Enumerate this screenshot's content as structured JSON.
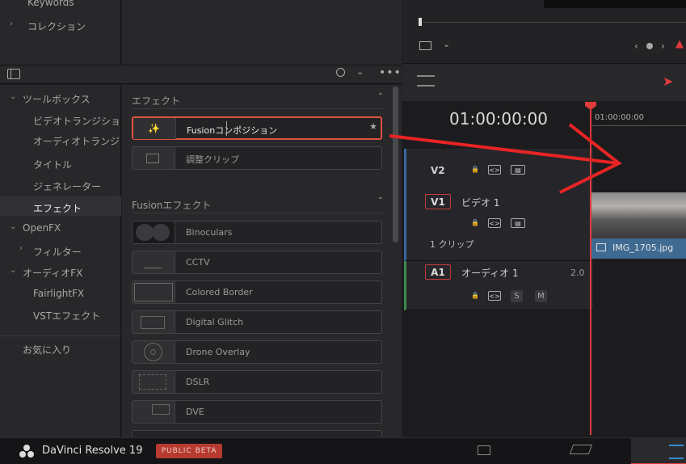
{
  "library": {
    "keywords": "Keywords",
    "collection": "コレクション"
  },
  "tree": {
    "toolbox": "ツールボックス",
    "video_transition": "ビデオトランジション",
    "audio_transition": "オーディオトランジシ...",
    "titles": "タイトル",
    "generators": "ジェネレーター",
    "effects": "エフェクト",
    "openfx": "OpenFX",
    "filters": "フィルター",
    "audiofx": "オーディオFX",
    "fairlightfx": "FairlightFX",
    "vst": "VSTエフェクト",
    "favorites": "お気に入り"
  },
  "effects_panel": {
    "section1": "エフェクト",
    "item_fusion": "Fusionコンポジション",
    "item_adjust": "調整クリップ",
    "section2": "Fusionエフェクト",
    "fusion_items": [
      "Binoculars",
      "CCTV",
      "Colored Border",
      "Digital Glitch",
      "Drone Overlay",
      "DSLR",
      "DVE"
    ]
  },
  "timeline": {
    "timecode": "01:00:00:00",
    "ruler_tc": "01:00:00:00",
    "v2": "V2",
    "v1": "V1",
    "v1_name": "ビデオ 1",
    "v1_clips": "1 クリップ",
    "a1": "A1",
    "a1_name": "オーディオ 1",
    "a1_ch": "2.0",
    "clip_name": "IMG_1705.jpg"
  },
  "bottom": {
    "app_name": "DaVinci Resolve 19",
    "beta": "PUBLIC BETA"
  },
  "colors": {
    "accent_red": "#e03b3b",
    "clip_blue": "#3f6a92"
  }
}
